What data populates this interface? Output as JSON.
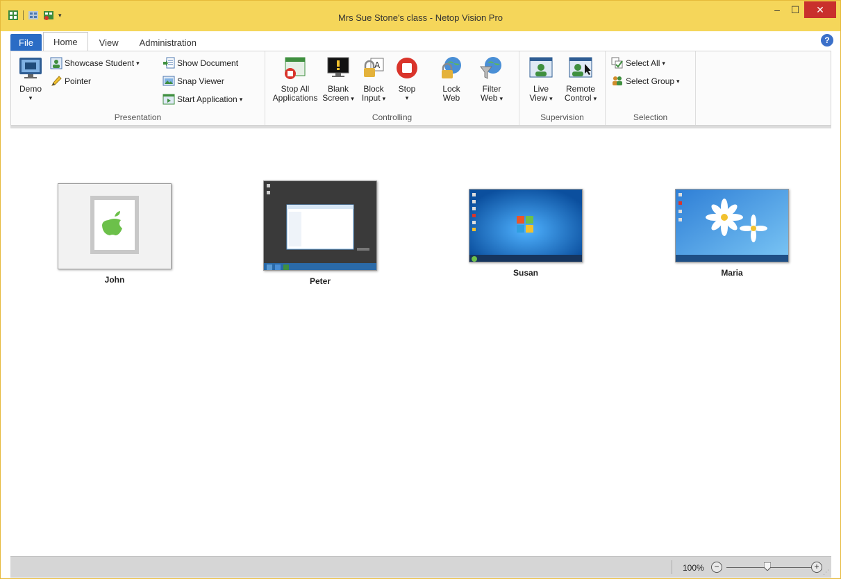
{
  "window": {
    "title": "Mrs Sue Stone's class - Netop Vision Pro",
    "controls": {
      "minimize": "–",
      "maximize": "☐",
      "close": "✕"
    }
  },
  "quick_access": {
    "dropdown_caret": "▾"
  },
  "tabs": [
    {
      "label": "File"
    },
    {
      "label": "Home",
      "active": true
    },
    {
      "label": "View"
    },
    {
      "label": "Administration"
    }
  ],
  "help": {
    "label": "?"
  },
  "dropdown_arrow": "▾",
  "ribbon": {
    "presentation": {
      "label": "Presentation",
      "demo": {
        "line1": "Demo"
      },
      "showcase_student": "Showcase Student",
      "pointer": "Pointer",
      "show_document": "Show Document",
      "snap_viewer": "Snap Viewer",
      "start_application": "Start Application"
    },
    "controlling": {
      "label": "Controlling",
      "stop_all_applications": {
        "line1": "Stop All",
        "line2": "Applications"
      },
      "blank_screen": {
        "line1": "Blank",
        "line2": "Screen"
      },
      "block_input": {
        "line1": "Block",
        "line2": "Input"
      },
      "stop": {
        "line1": "Stop"
      },
      "lock_web": {
        "line1": "Lock",
        "line2": "Web"
      },
      "filter_web": {
        "line1": "Filter",
        "line2": "Web"
      }
    },
    "supervision": {
      "label": "Supervision",
      "live_view": {
        "line1": "Live",
        "line2": "View"
      },
      "remote_control": {
        "line1": "Remote",
        "line2": "Control"
      }
    },
    "selection": {
      "label": "Selection",
      "select_all": "Select All",
      "select_group": "Select Group"
    }
  },
  "students": [
    {
      "name": "John",
      "platform": "mac-apple-icon"
    },
    {
      "name": "Peter",
      "platform": "windows-server-desktop"
    },
    {
      "name": "Susan",
      "platform": "windows-7-desktop"
    },
    {
      "name": "Maria",
      "platform": "windows-8-desktop"
    }
  ],
  "statusbar": {
    "zoom": "100%",
    "zoom_level_fraction": 0.45,
    "zoom_out": "−",
    "zoom_in": "+"
  },
  "colors": {
    "title_bar": "#f5d65a",
    "file_tab": "#2a6cc5",
    "close_button": "#c9302c",
    "apple_green": "#6cc04a"
  }
}
